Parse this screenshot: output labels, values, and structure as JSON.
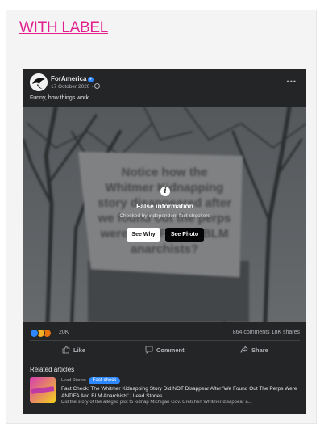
{
  "section": {
    "link_text": "WITH LABEL"
  },
  "post": {
    "page_name": "ForAmerica",
    "date": "17 October 2020 ·",
    "text": "Funny, how things work.",
    "more_icon": "more-horizontal-icon"
  },
  "photo": {
    "sign_lines": [
      "Notice how the",
      "Whitmer Kidnapping",
      "story disappeared after",
      "we found out the perps",
      "were ANTIFA and BLM",
      "anarchists?"
    ]
  },
  "fact_check_overlay": {
    "title": "False information",
    "subtitle": "Checked by independent fact-checkers",
    "see_why": "See Why",
    "see_photo": "See Photo"
  },
  "engagement": {
    "reaction_count": "20K",
    "comments_shares": "864 comments  18K shares"
  },
  "actions": {
    "like": "Like",
    "comment": "Comment",
    "share": "Share"
  },
  "related": {
    "heading": "Related articles",
    "source": "Lead Stories",
    "badge": "Fact-check",
    "title": "Fact Check: The Whitmer Kidnapping Story Did NOT Disappear After 'We Found Out The Perps Were ANTIFA And BLM Anarchists' | Lead Stories",
    "description": "Did the story of the alleged plot to kidnap Michigan Gov. Gretchen Whitmer disappear a..."
  },
  "colors": {
    "link": "#e21f8e",
    "post_bg": "#242526",
    "badge": "#2d88ff"
  }
}
